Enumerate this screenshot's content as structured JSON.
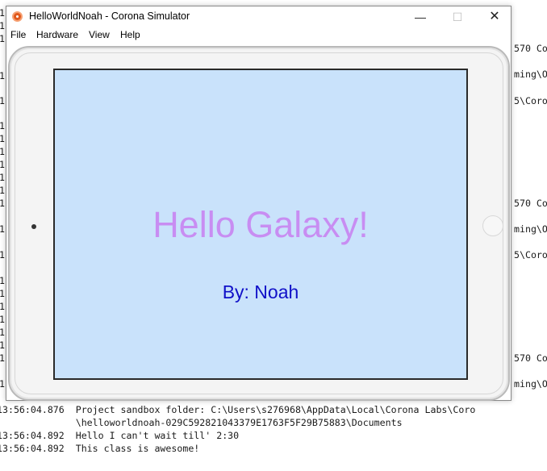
{
  "window": {
    "title": "HelloWorldNoah - Corona Simulator",
    "controls": {
      "minimize": "—",
      "maximize": "☐",
      "close": "✕"
    }
  },
  "menu": [
    "File",
    "Hardware",
    "View",
    "Help"
  ],
  "screen": {
    "headline": "Hello Galaxy!",
    "byline": "By: Noah"
  },
  "console": {
    "left_fragments": [
      "1",
      "1",
      "1",
      "1",
      "1",
      "1",
      "1",
      "1",
      "1",
      "1",
      "1",
      "1",
      "1",
      "1",
      "1",
      "1",
      "1",
      "1",
      "1",
      "1",
      "1",
      "1"
    ],
    "right_fragments": [
      "570 Co",
      "ming\\O",
      "5\\Coro",
      "570 Co",
      "ming\\O",
      "5\\Coro",
      "570 Co",
      "ming\\O"
    ],
    "bottom_lines": [
      "13:56:04.876  Project sandbox folder: C:\\Users\\s276968\\AppData\\Local\\Corona Labs\\Coro",
      "              \\helloworldnoah-029C592821043379E1763F5F29B75883\\Documents",
      "13:56:04.892  Hello I can't wait till' 2:30",
      "13:56:04.892  This class is awesome!"
    ]
  }
}
